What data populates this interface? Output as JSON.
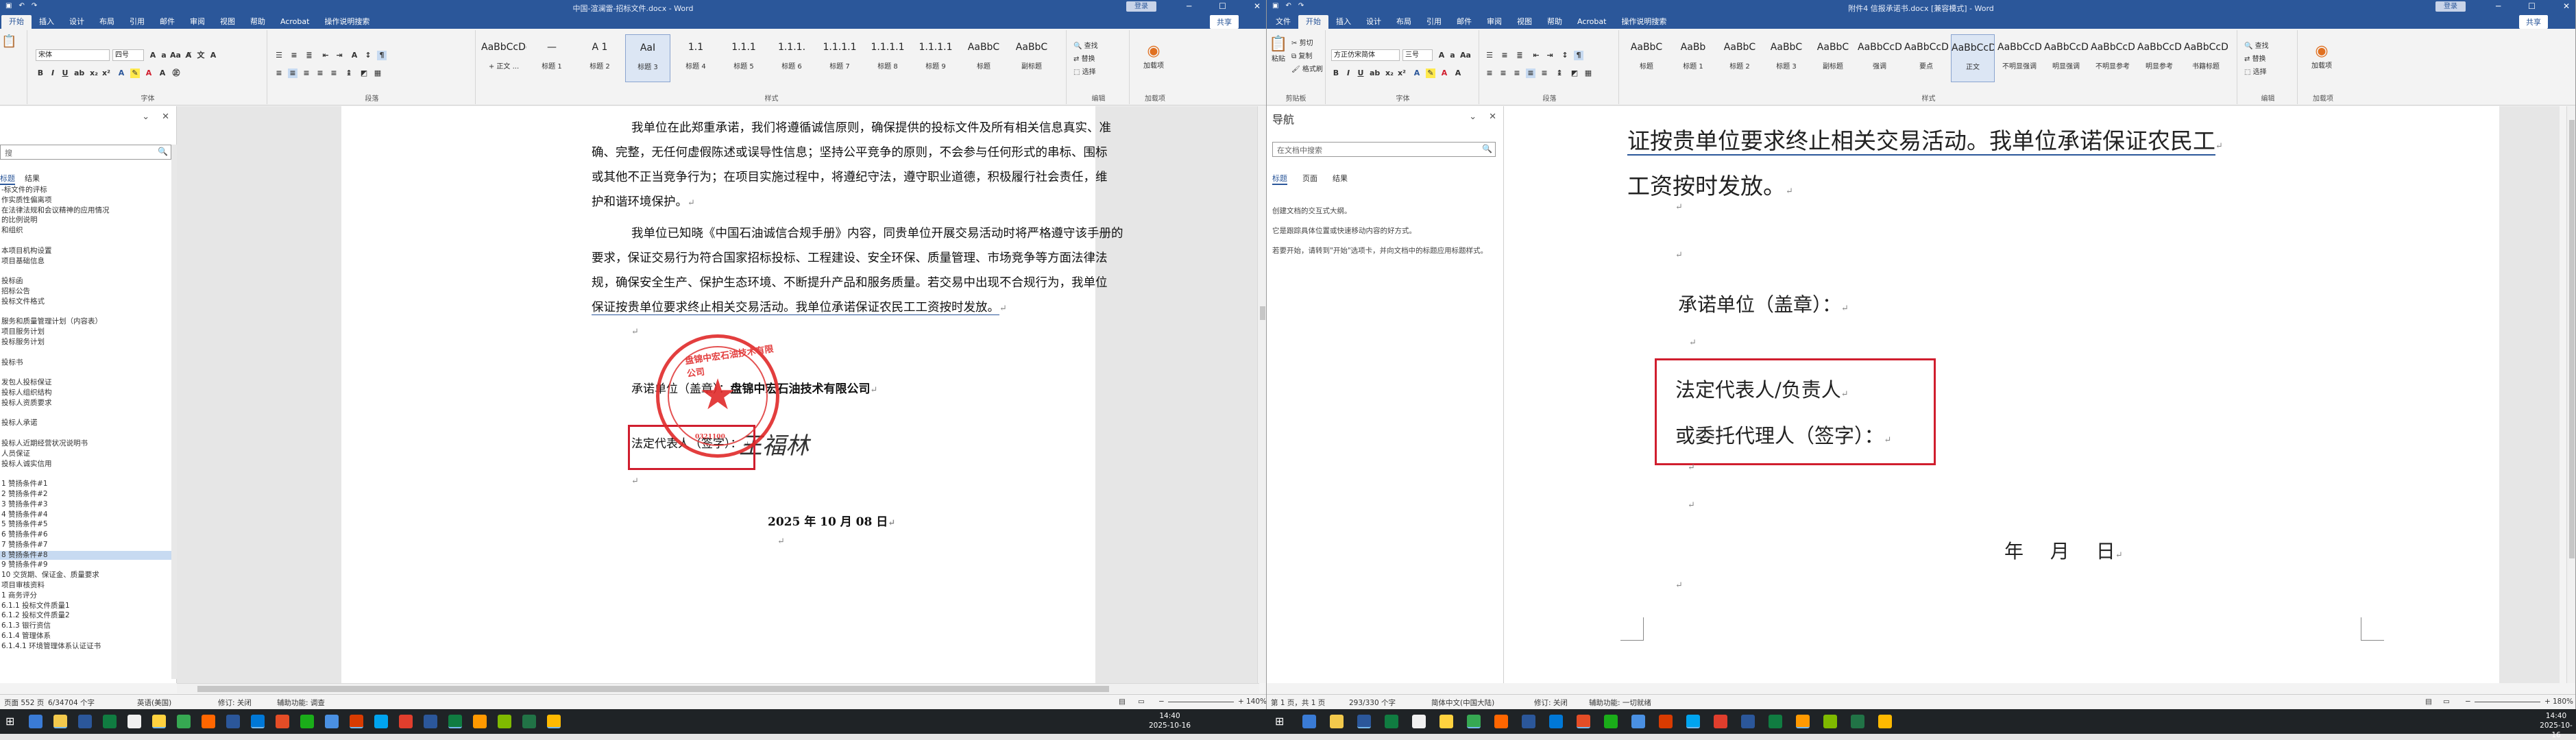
{
  "left": {
    "title": "中国-渲澜雷-招标文件.docx - Word",
    "login": "登录",
    "share": "共享",
    "menu": [
      "开始",
      "插入",
      "设计",
      "布局",
      "引用",
      "邮件",
      "审阅",
      "视图",
      "帮助",
      "Acrobat",
      "操作说明搜索"
    ],
    "font": {
      "name": "宋体",
      "size": "四号"
    },
    "groups": [
      "字体",
      "段落",
      "样式",
      "编辑",
      "加载项"
    ],
    "styles": [
      {
        "preview": "AaBbCcDd",
        "name": "+ 正文 ..."
      },
      {
        "preview": "—",
        "name": "标题 1"
      },
      {
        "preview": "A 1",
        "name": "标题 2"
      },
      {
        "preview": "AaI",
        "name": "标题 3"
      },
      {
        "preview": "1.1",
        "name": "标题 4"
      },
      {
        "preview": "1.1.1",
        "name": "标题 5"
      },
      {
        "preview": "1.1.1.",
        "name": "标题 6"
      },
      {
        "preview": "1.1.1.1",
        "name": "标题 7"
      },
      {
        "preview": "1.1.1.1",
        "name": "标题 8"
      },
      {
        "preview": "1.1.1.1",
        "name": "标题 9"
      },
      {
        "preview": "AaBbC",
        "name": "标题"
      },
      {
        "preview": "AaBbC",
        "name": "副标题"
      }
    ],
    "editing": [
      "查找",
      "替换",
      "选择"
    ],
    "addin": "加载项",
    "nav": {
      "search_placeholder": "搜",
      "tabs": [
        "标题",
        "结果"
      ],
      "items": [
        "-标文件的评标",
        "作实质性偏离项",
        "在法律法规和会议精神的应用情况",
        "的比例说明",
        "和组织",
        "",
        "本项目机构设置",
        "项目基础信息",
        "",
        "投标函",
        "招标公告",
        "投标文件格式",
        "",
        "服务和质量管理计划（内容表）",
        "项目服务计划",
        "投标服务计划",
        "",
        "投标书",
        "",
        "发包人投标保证",
        "投标人组织结构",
        "投标人资质要求",
        "",
        "投标人承诺",
        "",
        "投标人近期经营状况说明书",
        "人员保证",
        "投标人诚实信用",
        "",
        "1 赞扬条件#1",
        "2 赞扬条件#2",
        "3 赞扬条件#3",
        "4 赞扬条件#4",
        "5 赞扬条件#5",
        "6 赞扬条件#6",
        "7 赞扬条件#7",
        "8 赞扬条件#8",
        "9 赞扬条件#9",
        "10 交货期、保证金、质量要求",
        "项目审核资料",
        "1 商务评分",
        "6.1.1 投标文件质量1",
        "6.1.2 投标文件质量2",
        "6.1.3 银行资信",
        "6.1.4 管理体系",
        "6.1.4.1 环境管理体系认证证书"
      ],
      "selected": 36
    },
    "doc": {
      "p1": [
        "我单位在此郑重承诺，我们将遵循诚信原则，确保提供的投标文件及所有相关信息真实、准",
        "确、完整，无任何虚假陈述或误导性信息；坚持公平竞争的原则，不会参与任何形式的串标、围标",
        "或其他不正当竞争行为；在项目实施过程中，将遵纪守法，遵守职业道德，积极履行社会责任，维",
        "护和谐环境保护。"
      ],
      "p2": [
        "我单位已知晓《中国石油诚信合规手册》内容，同贵单位开展交易活动时将严格遵守该手册的",
        "要求，保证交易行为符合国家招标投标、工程建设、安全环保、质量管理、市场竞争等方面法律法",
        "规，确保安全生产、保护生态环境、不断提升产品和服务质量。若交易中出现不合规行为，我单位",
        "保证按贵单位要求终止相关交易活动。我单位承诺保证农民工工资按时发放。"
      ],
      "unit_label": "承诺单位（盖章）：",
      "company": "盘锦中宏石油技术有限公司",
      "rep_label": "法定代表人（签字）：",
      "signature": "王福林",
      "date": "2025 年 10 月 08 日",
      "stamp_name": "盘锦中宏石油技术有限公司",
      "stamp_code": "0321100"
    },
    "status": {
      "page": "页面 552 页",
      "words": "6/34704 个字",
      "lang": "英语(美国)",
      "track": "修订: 关闭",
      "access": "辅助功能: 调查",
      "zoom": "140%"
    }
  },
  "right": {
    "title": "附件4  信报承诺书.docx [兼容模式] - Word",
    "login": "登录",
    "share": "共享",
    "menu": [
      "文件",
      "开始",
      "插入",
      "设计",
      "布局",
      "引用",
      "邮件",
      "审阅",
      "视图",
      "帮助",
      "Acrobat",
      "操作说明搜索"
    ],
    "font": {
      "name": "方正仿宋简体",
      "size": "三号"
    },
    "groups": [
      "剪贴板",
      "字体",
      "段落",
      "样式",
      "编辑",
      "加载项"
    ],
    "clipboard": [
      "剪切",
      "复制",
      "格式刷",
      "粘贴"
    ],
    "styles": [
      {
        "preview": "AaBbC",
        "name": "标题"
      },
      {
        "preview": "AaBb",
        "name": "标题 1"
      },
      {
        "preview": "AaBbC",
        "name": "标题 2"
      },
      {
        "preview": "AaBbC",
        "name": "标题 3"
      },
      {
        "preview": "AaBbC",
        "name": "副标题"
      },
      {
        "preview": "AaBbCcDc",
        "name": "强调"
      },
      {
        "preview": "AaBbCcD",
        "name": "要点"
      },
      {
        "preview": "AaBbCcDd",
        "name": "正文"
      },
      {
        "preview": "AaBbCcDc",
        "name": "不明显强调"
      },
      {
        "preview": "AaBbCcDc",
        "name": "明显强调"
      },
      {
        "preview": "AaBbCcD",
        "name": "不明显参考"
      },
      {
        "preview": "AaBbCcD",
        "name": "明显参考"
      },
      {
        "preview": "AaBbCcD",
        "name": "书籍标题"
      }
    ],
    "editing": [
      "查找",
      "替换",
      "选择"
    ],
    "addin": "加载项",
    "nav": {
      "title": "导航",
      "search_placeholder": "在文档中搜索",
      "tabs": [
        "标题",
        "页面",
        "结果"
      ],
      "hint1": "创建文档的交互式大纲。",
      "hint2": "它是跟踪具体位置或快速移动内容的好方式。",
      "hint3": "若要开始，请转到\"开始\"选项卡，并向文档中的标题应用标题样式。"
    },
    "doc": {
      "line1": "证按贵单位要求终止相关交易活动。我单位承诺保证农民工",
      "line2": "工资按时发放。",
      "unit_label": "承诺单位（盖章）：",
      "rep_label": "法定代表人/负责人",
      "agent_label": "或委托代理人（签字）：",
      "date": "年  月  日"
    },
    "status": {
      "page": "第 1 页，共 1 页",
      "words": "293/330 个字",
      "lang": "简体中文(中国大陆)",
      "track": "修订: 关闭",
      "access": "辅助功能: 一切就绪",
      "zoom": "180%"
    }
  },
  "taskbar": {
    "time1": "14:40",
    "date1": "2025-10-16",
    "time2": "14:40",
    "date2": "2025-10-16",
    "colors": [
      "#3a7bd5",
      "#f2c94c",
      "#2b579a",
      "#107c41",
      "#f0f0f0",
      "#ffd23f",
      "#36a852",
      "#ff6600",
      "#2b579a",
      "#0078d7",
      "#e44d26",
      "#1aad19",
      "#4a90e2",
      "#d83b01",
      "#00a4ef",
      "#e03e2d",
      "#2b579a",
      "#107c41",
      "#ff9900",
      "#7fba00",
      "#217346",
      "#ffb900"
    ]
  }
}
